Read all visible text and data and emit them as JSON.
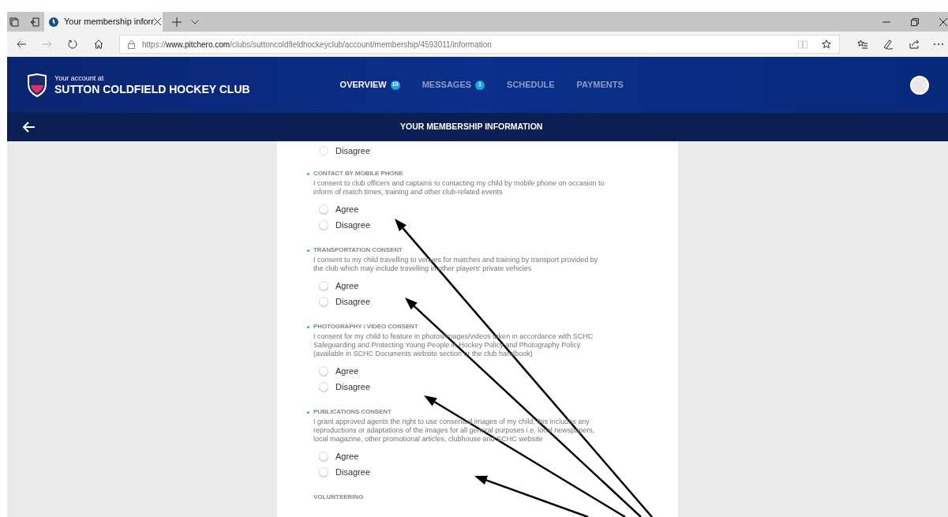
{
  "browser": {
    "tabs": [
      {
        "title": "Your membership inforr",
        "selected": true
      }
    ],
    "url": {
      "scheme": "https://",
      "domain": "www.pitchero.com",
      "path": "/clubs/suttoncoldfieldhockeyclub/account/membership/4593011/information"
    }
  },
  "header": {
    "account_label": "Your account at",
    "club_name": "SUTTON COLDFIELD HOCKEY CLUB",
    "nav": [
      {
        "label": "OVERVIEW",
        "badge": "10",
        "selected": true
      },
      {
        "label": "MESSAGES",
        "badge": "1",
        "selected": false
      },
      {
        "label": "SCHEDULE",
        "selected": false
      },
      {
        "label": "PAYMENTS",
        "selected": false
      }
    ]
  },
  "subheader": {
    "title": "YOUR MEMBERSHIP INFORMATION"
  },
  "form": {
    "cut_top_option": "Disagree",
    "sections": [
      {
        "title": "CONTACT BY MOBILE PHONE",
        "description": "I consent to club officers and captains to contacting my child by mobile phone on occasion to inform of match times, training and other club-related events",
        "options": [
          {
            "label": "Agree",
            "selected": false
          },
          {
            "label": "Disagree",
            "selected": false
          }
        ]
      },
      {
        "title": "TRANSPORTATION CONSENT",
        "description": "I consent to my child travelling to venues for matches and training by transport provided by the club which may include travelling in other players' private vehicles",
        "options": [
          {
            "label": "Agree",
            "selected": false
          },
          {
            "label": "Disagree",
            "selected": false
          }
        ]
      },
      {
        "title": "PHOTOGRAPHY / VIDEO CONSENT",
        "description": "I consent for my child to feature in photos/images/videos taken in accordance with SCHC Safeguarding and Protecting Young People in Hockey Policy and Photography Policy (available in SCHC Documents website section or the club handbook)",
        "options": [
          {
            "label": "Agree",
            "selected": false
          },
          {
            "label": "Disagree",
            "selected": false
          }
        ]
      },
      {
        "title": "PUBLICATIONS CONSENT",
        "description": "I grant approved agents the right to use consented images of my child, this includes any reproductions or adaptations of the images for all general purposes i.e. local newspapers, local magazine, other promotional articles, clubhouse and SCHC website",
        "options": [
          {
            "label": "Agree",
            "selected": false
          },
          {
            "label": "Disagree",
            "selected": false
          }
        ]
      }
    ],
    "cut_bottom_heading": "VOLUNTEERING"
  }
}
